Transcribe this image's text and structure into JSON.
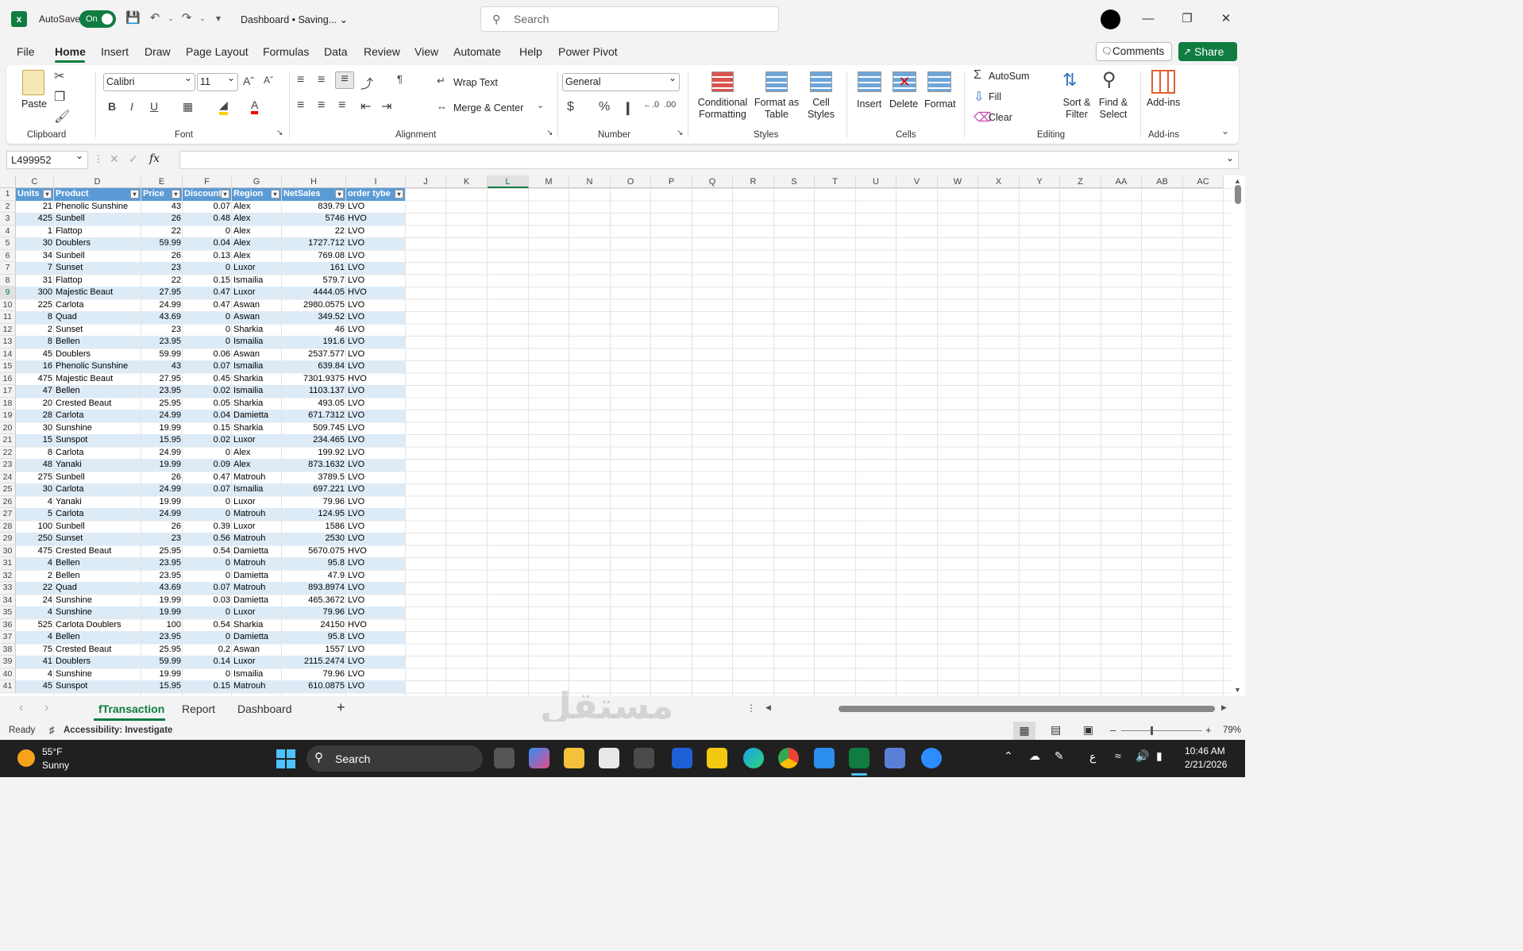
{
  "titlebar": {
    "autosave_label": "AutoSave",
    "autosave_state": "On",
    "doc_title": "Dashboard • Saving...",
    "search_placeholder": "Search",
    "win_min": "—",
    "win_restore": "❐",
    "win_close": "✕"
  },
  "menu": {
    "tabs": [
      "File",
      "Home",
      "Insert",
      "Draw",
      "Page Layout",
      "Formulas",
      "Data",
      "Review",
      "View",
      "Automate",
      "Help",
      "Power Pivot"
    ],
    "active": "Home",
    "comments": "Comments",
    "share": "Share"
  },
  "ribbon": {
    "clipboard": {
      "label": "Clipboard",
      "paste": "Paste"
    },
    "font": {
      "label": "Font",
      "name": "Calibri",
      "size": "11"
    },
    "alignment": {
      "label": "Alignment",
      "wrap": "Wrap Text",
      "merge": "Merge & Center"
    },
    "number": {
      "label": "Number",
      "format": "General"
    },
    "styles": {
      "label": "Styles",
      "conditional": [
        "Conditional",
        "Formatting"
      ],
      "format_table": [
        "Format as",
        "Table"
      ],
      "cell_styles": [
        "Cell",
        "Styles"
      ]
    },
    "cells": {
      "label": "Cells",
      "insert": "Insert",
      "delete": "Delete",
      "format": "Format"
    },
    "editing": {
      "label": "Editing",
      "autosum": "AutoSum",
      "fill": "Fill",
      "clear": "Clear",
      "sort": [
        "Sort &",
        "Filter"
      ],
      "find": [
        "Find &",
        "Select"
      ]
    },
    "addins": {
      "label": "Add-ins",
      "addins": "Add-ins"
    }
  },
  "formula_bar": {
    "name_box": "L499952",
    "fx": "fx",
    "value": ""
  },
  "columns": [
    "C",
    "D",
    "E",
    "F",
    "G",
    "H",
    "I",
    "J",
    "K",
    "L",
    "M",
    "N",
    "O",
    "P",
    "Q",
    "R",
    "S",
    "T",
    "U",
    "V",
    "W",
    "X",
    "Y",
    "Z",
    "AA",
    "AB",
    "AC"
  ],
  "selected_column": "L",
  "selected_row": 9,
  "table": {
    "headers": [
      "Units",
      "Product",
      "Price",
      "Discount",
      "Region",
      "NetSales",
      "order tybe"
    ],
    "rows": [
      [
        "21",
        "Phenolic Sunshine",
        "43",
        "0.07",
        "Alex",
        "839.79",
        "LVO"
      ],
      [
        "425",
        "Sunbell",
        "26",
        "0.48",
        "Alex",
        "5746",
        "HVO"
      ],
      [
        "1",
        "Flattop",
        "22",
        "0",
        "Alex",
        "22",
        "LVO"
      ],
      [
        "30",
        "Doublers",
        "59.99",
        "0.04",
        "Alex",
        "1727.712",
        "LVO"
      ],
      [
        "34",
        "Sunbell",
        "26",
        "0.13",
        "Alex",
        "769.08",
        "LVO"
      ],
      [
        "7",
        "Sunset",
        "23",
        "0",
        "Luxor",
        "161",
        "LVO"
      ],
      [
        "31",
        "Flattop",
        "22",
        "0.15",
        "Ismailia",
        "579.7",
        "LVO"
      ],
      [
        "300",
        "Majestic Beaut",
        "27.95",
        "0.47",
        "Luxor",
        "4444.05",
        "HVO"
      ],
      [
        "225",
        "Carlota",
        "24.99",
        "0.47",
        "Aswan",
        "2980.0575",
        "LVO"
      ],
      [
        "8",
        "Quad",
        "43.69",
        "0",
        "Aswan",
        "349.52",
        "LVO"
      ],
      [
        "2",
        "Sunset",
        "23",
        "0",
        "Sharkia",
        "46",
        "LVO"
      ],
      [
        "8",
        "Bellen",
        "23.95",
        "0",
        "Ismailia",
        "191.6",
        "LVO"
      ],
      [
        "45",
        "Doublers",
        "59.99",
        "0.06",
        "Aswan",
        "2537.577",
        "LVO"
      ],
      [
        "16",
        "Phenolic Sunshine",
        "43",
        "0.07",
        "Ismailia",
        "639.84",
        "LVO"
      ],
      [
        "475",
        "Majestic Beaut",
        "27.95",
        "0.45",
        "Sharkia",
        "7301.9375",
        "HVO"
      ],
      [
        "47",
        "Bellen",
        "23.95",
        "0.02",
        "Ismailia",
        "1103.137",
        "LVO"
      ],
      [
        "20",
        "Crested Beaut",
        "25.95",
        "0.05",
        "Sharkia",
        "493.05",
        "LVO"
      ],
      [
        "28",
        "Carlota",
        "24.99",
        "0.04",
        "Damietta",
        "671.7312",
        "LVO"
      ],
      [
        "30",
        "Sunshine",
        "19.99",
        "0.15",
        "Sharkia",
        "509.745",
        "LVO"
      ],
      [
        "15",
        "Sunspot",
        "15.95",
        "0.02",
        "Luxor",
        "234.465",
        "LVO"
      ],
      [
        "8",
        "Carlota",
        "24.99",
        "0",
        "Alex",
        "199.92",
        "LVO"
      ],
      [
        "48",
        "Yanaki",
        "19.99",
        "0.09",
        "Alex",
        "873.1632",
        "LVO"
      ],
      [
        "275",
        "Sunbell",
        "26",
        "0.47",
        "Matrouh",
        "3789.5",
        "LVO"
      ],
      [
        "30",
        "Carlota",
        "24.99",
        "0.07",
        "Ismailia",
        "697.221",
        "LVO"
      ],
      [
        "4",
        "Yanaki",
        "19.99",
        "0",
        "Luxor",
        "79.96",
        "LVO"
      ],
      [
        "5",
        "Carlota",
        "24.99",
        "0",
        "Matrouh",
        "124.95",
        "LVO"
      ],
      [
        "100",
        "Sunbell",
        "26",
        "0.39",
        "Luxor",
        "1586",
        "LVO"
      ],
      [
        "250",
        "Sunset",
        "23",
        "0.56",
        "Matrouh",
        "2530",
        "LVO"
      ],
      [
        "475",
        "Crested Beaut",
        "25.95",
        "0.54",
        "Damietta",
        "5670.075",
        "HVO"
      ],
      [
        "4",
        "Bellen",
        "23.95",
        "0",
        "Matrouh",
        "95.8",
        "LVO"
      ],
      [
        "2",
        "Bellen",
        "23.95",
        "0",
        "Damietta",
        "47.9",
        "LVO"
      ],
      [
        "22",
        "Quad",
        "43.69",
        "0.07",
        "Matrouh",
        "893.8974",
        "LVO"
      ],
      [
        "24",
        "Sunshine",
        "19.99",
        "0.03",
        "Damietta",
        "465.3672",
        "LVO"
      ],
      [
        "4",
        "Sunshine",
        "19.99",
        "0",
        "Luxor",
        "79.96",
        "LVO"
      ],
      [
        "525",
        "Carlota Doublers",
        "100",
        "0.54",
        "Sharkia",
        "24150",
        "HVO"
      ],
      [
        "4",
        "Bellen",
        "23.95",
        "0",
        "Damietta",
        "95.8",
        "LVO"
      ],
      [
        "75",
        "Crested Beaut",
        "25.95",
        "0.2",
        "Aswan",
        "1557",
        "LVO"
      ],
      [
        "41",
        "Doublers",
        "59.99",
        "0.14",
        "Luxor",
        "2115.2474",
        "LVO"
      ],
      [
        "4",
        "Sunshine",
        "19.99",
        "0",
        "Ismailia",
        "79.96",
        "LVO"
      ],
      [
        "45",
        "Sunspot",
        "15.95",
        "0.15",
        "Matrouh",
        "610.0875",
        "LVO"
      ]
    ]
  },
  "sheets": {
    "tabs": [
      "fTransaction",
      "Report",
      "Dashboard"
    ],
    "active": "fTransaction",
    "add": "+"
  },
  "status": {
    "ready": "Ready",
    "accessibility": "Accessibility: Investigate",
    "zoom": "79%"
  },
  "taskbar": {
    "temp": "55°F",
    "weather": "Sunny",
    "search": "Search",
    "time": "10:46 AM",
    "date": "2/21/2026",
    "lang": "ع"
  },
  "watermark": "مستقل"
}
